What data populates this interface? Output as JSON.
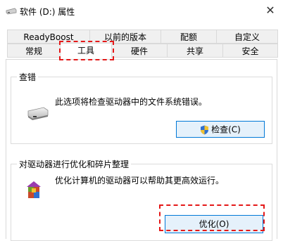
{
  "window": {
    "title": "软件 (D:) 属性",
    "close_glyph": "✕"
  },
  "tabs": {
    "row1": [
      "ReadyBoost",
      "以前的版本",
      "配额",
      "自定义"
    ],
    "row2": [
      "常规",
      "工具",
      "硬件",
      "共享",
      "安全"
    ],
    "active": "工具"
  },
  "error_check": {
    "title": "查错",
    "description": "此选项将检查驱动器中的文件系统错误。",
    "button": "检查(C)",
    "icon": "drive-icon",
    "button_icon": "shield-icon"
  },
  "optimize": {
    "title": "对驱动器进行优化和碎片整理",
    "description": "优化计算机的驱动器可以帮助其更高效运行。",
    "button": "优化(O)",
    "icon": "defrag-icon"
  },
  "colors": {
    "highlight": "#e41818",
    "accent": "#0078d7"
  }
}
